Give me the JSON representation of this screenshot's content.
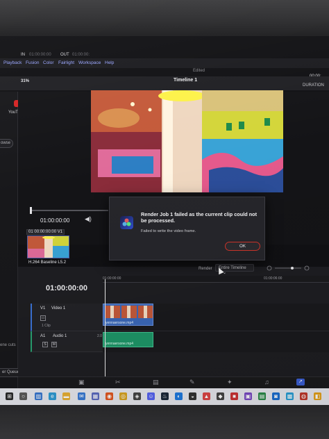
{
  "menu": {
    "items": [
      "Playback",
      "Fusion",
      "Color",
      "Fairlight",
      "Workspace",
      "Help"
    ]
  },
  "header": {
    "edited": "Edited",
    "timecode_right": "00:00:",
    "zoom": "31%",
    "in_label": "IN",
    "in_value": "01:00:00:00",
    "out_label": "OUT",
    "out_value": "01:00:00:",
    "timeline_name": "Timeline 1",
    "duration_label": "DURATION"
  },
  "left_panel": {
    "youtube_label": "YouTu",
    "browse": "owse",
    "scene_cuts": "ene cuts",
    "render_queue": "er Queue"
  },
  "viewer": {
    "timecode": "01:00:00:00"
  },
  "media_pool": {
    "clip_badge_num": "01",
    "clip_badge_tc": "00:00:00:00",
    "clip_badge_track": "V1",
    "clip_name": "H.264 Baseline L5.2"
  },
  "timeline": {
    "render_label": "Render",
    "render_option": "Entire Timeline",
    "timecode": "01:00:00:00",
    "ruler_start": "01:00:00:00",
    "ruler_mid": "01:00:06:00",
    "v1_id": "V1",
    "v1_name": "Video 1",
    "v1_clips": "1 Clip",
    "a1_id": "A1",
    "a1_name": "Audio 1",
    "a1_level": "2.0",
    "a1_solo": "S",
    "a1_mute": "M",
    "video_clip_name": "yennaersone.mp4",
    "audio_clip_name": "yennaersone.mp4"
  },
  "dialog": {
    "title": "Render Job 1 failed as the current clip could not be processed.",
    "message": "Failed to write the video frame.",
    "ok": "OK"
  },
  "colors": {
    "accent": "#3b68b8",
    "audio": "#1e9668",
    "ok_border": "#d0352b"
  }
}
